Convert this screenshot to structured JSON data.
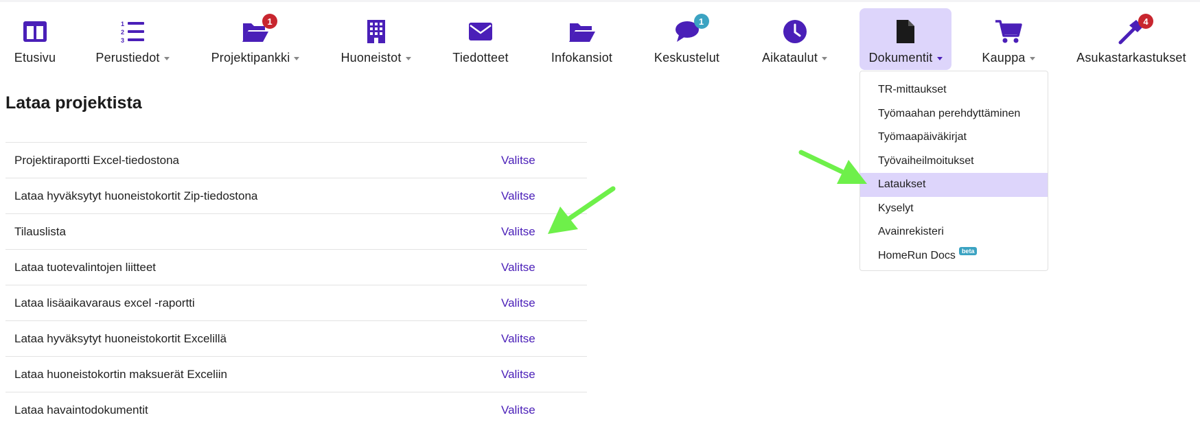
{
  "nav": {
    "items": [
      {
        "label": "Etusivu",
        "icon": "dashboard-icon",
        "caret": false,
        "badge": null
      },
      {
        "label": "Perustiedot",
        "icon": "list-ordered-icon",
        "caret": true,
        "badge": null
      },
      {
        "label": "Projektipankki",
        "icon": "folder-open-icon",
        "caret": true,
        "badge": "1"
      },
      {
        "label": "Huoneistot",
        "icon": "building-icon",
        "caret": true,
        "badge": null
      },
      {
        "label": "Tiedotteet",
        "icon": "envelope-icon",
        "caret": false,
        "badge": null
      },
      {
        "label": "Infokansiot",
        "icon": "folder-open-icon",
        "caret": false,
        "badge": null
      },
      {
        "label": "Keskustelut",
        "icon": "chat-icon",
        "caret": false,
        "badge": "1"
      },
      {
        "label": "Aikataulut",
        "icon": "clock-icon",
        "caret": true,
        "badge": null
      },
      {
        "label": "Dokumentit",
        "icon": "document-icon",
        "caret": true,
        "badge": null,
        "active": true
      },
      {
        "label": "Kauppa",
        "icon": "cart-icon",
        "caret": true,
        "badge": null
      },
      {
        "label": "Asukastarkastukset",
        "icon": "hammer-icon",
        "caret": false,
        "badge": "4"
      }
    ]
  },
  "page": {
    "title": "Lataa projektista",
    "rows": [
      {
        "label": "Projektiraportti Excel-tiedostona",
        "action": "Valitse"
      },
      {
        "label": "Lataa hyväksytyt huoneistokortit Zip-tiedostona",
        "action": "Valitse"
      },
      {
        "label": "Tilauslista",
        "action": "Valitse"
      },
      {
        "label": "Lataa tuotevalintojen liitteet",
        "action": "Valitse"
      },
      {
        "label": "Lataa lisäaikavaraus excel -raportti",
        "action": "Valitse"
      },
      {
        "label": "Lataa hyväksytyt huoneistokortit Excelillä",
        "action": "Valitse"
      },
      {
        "label": "Lataa huoneistokortin maksuerät Exceliin",
        "action": "Valitse"
      },
      {
        "label": "Lataa havaintodokumentit",
        "action": "Valitse"
      }
    ]
  },
  "dropdown": {
    "items": [
      {
        "label": "TR-mittaukset"
      },
      {
        "label": "Työmaahan perehdyttäminen"
      },
      {
        "label": "Työmaapäiväkirjat"
      },
      {
        "label": "Työvaiheilmoitukset"
      },
      {
        "label": "Lataukset",
        "active": true
      },
      {
        "label": "Kyselyt"
      },
      {
        "label": "Avainrekisteri"
      },
      {
        "label": "HomeRun Docs",
        "tag": "beta"
      }
    ]
  },
  "colors": {
    "accent": "#4a1fb8",
    "active_bg": "#ddd5fb",
    "badge_red": "#c8262f",
    "badge_teal": "#3ba3c2",
    "annotation_arrow": "#6ef04a"
  }
}
